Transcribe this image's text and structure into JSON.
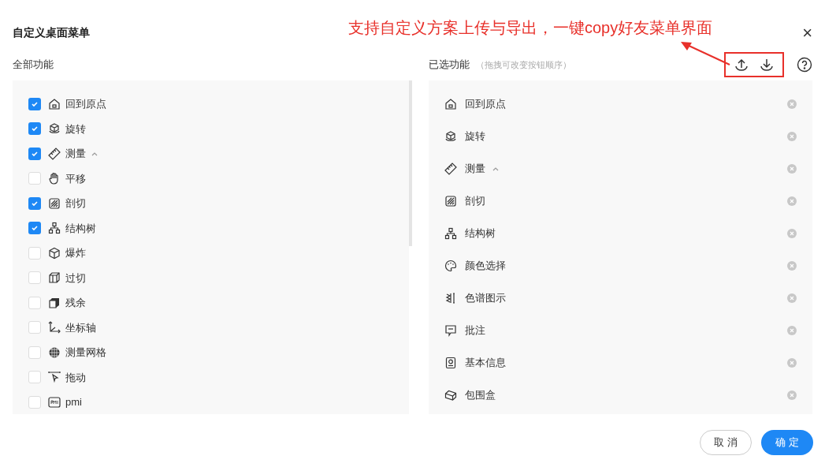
{
  "dialog": {
    "title": "自定义桌面菜单",
    "close": "×"
  },
  "annotation": "支持自定义方案上传与导出，一键copy好友菜单界面",
  "all_functions": {
    "heading": "全部功能",
    "items": [
      {
        "label": "回到原点",
        "checked": true
      },
      {
        "label": "旋转",
        "checked": true
      },
      {
        "label": "测量",
        "checked": true,
        "expanded": true
      },
      {
        "label": "平移",
        "checked": false
      },
      {
        "label": "剖切",
        "checked": true
      },
      {
        "label": "结构树",
        "checked": true
      },
      {
        "label": "爆炸",
        "checked": false
      },
      {
        "label": "过切",
        "checked": false
      },
      {
        "label": "残余",
        "checked": false
      },
      {
        "label": "坐标轴",
        "checked": false
      },
      {
        "label": "测量网格",
        "checked": false
      },
      {
        "label": "拖动",
        "checked": false
      },
      {
        "label": "pmi",
        "checked": false
      }
    ]
  },
  "selected_functions": {
    "heading": "已选功能",
    "hint": "（拖拽可改变按钮顺序）",
    "items": [
      {
        "label": "回到原点"
      },
      {
        "label": "旋转"
      },
      {
        "label": "测量",
        "expanded": true
      },
      {
        "label": "剖切"
      },
      {
        "label": "结构树"
      },
      {
        "label": "颜色选择"
      },
      {
        "label": "色谱图示"
      },
      {
        "label": "批注"
      },
      {
        "label": "基本信息"
      },
      {
        "label": "包围盒"
      }
    ]
  },
  "buttons": [
    {
      "label": "取 消",
      "kind": "secondary"
    },
    {
      "label": "确 定",
      "kind": "primary"
    }
  ]
}
